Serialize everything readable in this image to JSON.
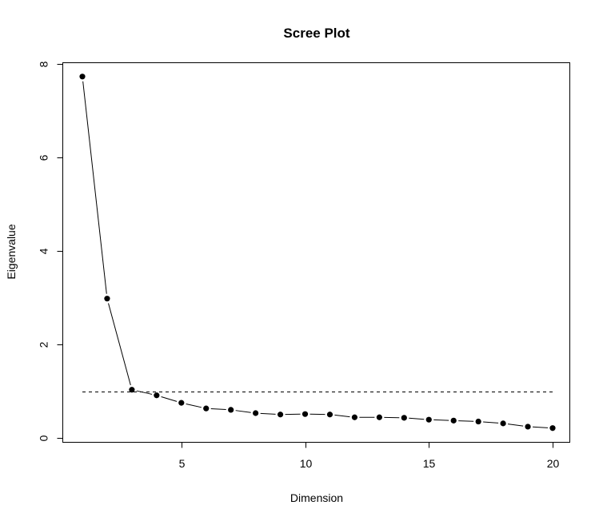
{
  "chart_data": {
    "type": "line",
    "title": "Scree Plot",
    "xlabel": "Dimension",
    "ylabel": "Eigenvalue",
    "x": [
      1,
      2,
      3,
      4,
      5,
      6,
      7,
      8,
      9,
      10,
      11,
      12,
      13,
      14,
      15,
      16,
      17,
      18,
      19,
      20
    ],
    "series": [
      {
        "name": "Eigenvalue",
        "values": [
          7.73,
          2.98,
          1.03,
          0.91,
          0.75,
          0.63,
          0.6,
          0.53,
          0.5,
          0.51,
          0.5,
          0.44,
          0.44,
          0.43,
          0.39,
          0.37,
          0.35,
          0.31,
          0.24,
          0.21
        ],
        "color": "#000000",
        "marker": "filled-circle"
      }
    ],
    "reference_line": {
      "y": 1,
      "x_from": 1,
      "x_to": 20,
      "style": "dashed",
      "color": "#000000"
    },
    "xticks": [
      5,
      10,
      15,
      20
    ],
    "xtick_labels": [
      "5",
      "10",
      "15",
      "20"
    ],
    "yticks": [
      0,
      2,
      4,
      6,
      8
    ],
    "ytick_labels": [
      "0",
      "2",
      "4",
      "6",
      "8"
    ],
    "xlim": [
      0.18,
      20.9
    ],
    "ylim": [
      -0.1,
      8.0
    ],
    "grid": false,
    "legend": "none"
  }
}
